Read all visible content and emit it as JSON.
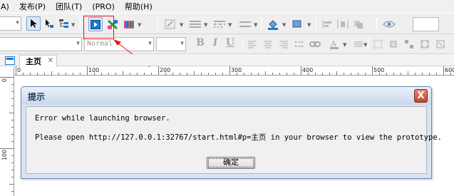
{
  "menu": [
    "A)",
    "发布(P)",
    "团队(T)",
    "(PRO)",
    "帮助(H)"
  ],
  "toolbar": {
    "font_style_placeholder": "Normal",
    "bold_label": "B",
    "italic_label": "I",
    "underline_label": "U",
    "colors": {
      "accent": "#1a78d2",
      "highlight_red": "#e8141b"
    }
  },
  "tab": {
    "label": "主页",
    "close": "×"
  },
  "ruler": {
    "h_labels": [
      "0",
      "100",
      "200",
      "300",
      "400",
      "500",
      "600"
    ],
    "v_labels": [
      "0",
      "100"
    ]
  },
  "dialog": {
    "title": "提示",
    "close": "X",
    "message1": "Error while launching browser.",
    "message2": "Please open http://127.0.0.1:32767/start.html#p=主页 in your browser to view the prototype.",
    "ok_label": "确定"
  }
}
